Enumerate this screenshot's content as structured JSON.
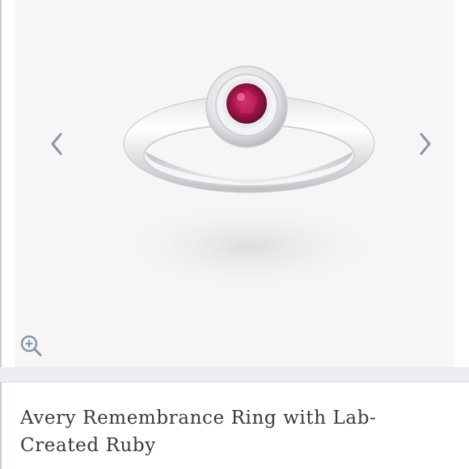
{
  "product": {
    "title": "Avery Remembrance Ring with Lab-Created Ruby"
  },
  "gallery": {
    "prev_icon": "chevron-left-icon",
    "next_icon": "chevron-right-icon",
    "zoom_icon": "zoom-in-icon",
    "arrow_color": "#8a94a6",
    "stone_color": "#9e1a4a"
  }
}
